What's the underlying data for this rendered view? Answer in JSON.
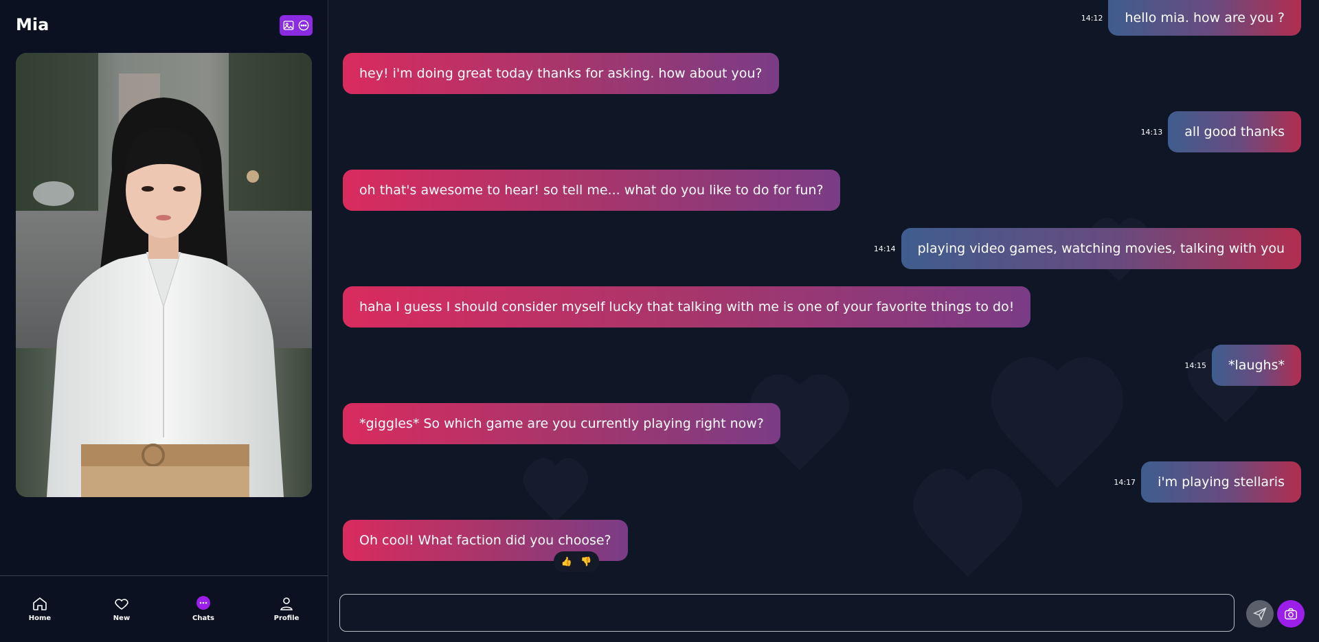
{
  "sidebar": {
    "title": "Mia",
    "action_icons": [
      "image-icon",
      "chat-dots-icon"
    ],
    "portrait": "profile-photo"
  },
  "nav": {
    "items": [
      {
        "label": "Home",
        "icon": "home-icon"
      },
      {
        "label": "New",
        "icon": "heart-icon"
      },
      {
        "label": "Chats",
        "icon": "chat-bubble-icon",
        "active": true
      },
      {
        "label": "Profile",
        "icon": "user-icon"
      }
    ]
  },
  "messages": [
    {
      "from": "me",
      "time": "14:12",
      "text": "hello mia. how are you ?"
    },
    {
      "from": "bot",
      "text": "hey! i'm doing great today thanks for asking. how about you?"
    },
    {
      "from": "me",
      "time": "14:13",
      "text": "all good thanks"
    },
    {
      "from": "bot",
      "text": "oh that's awesome to hear! so tell me... what do you like to do for fun?"
    },
    {
      "from": "me",
      "time": "14:14",
      "text": "playing video games, watching movies, talking with you"
    },
    {
      "from": "bot",
      "text": "haha I guess I should consider myself lucky that talking with me is one of your favorite things to do!"
    },
    {
      "from": "me",
      "time": "14:15",
      "text": "*laughs*"
    },
    {
      "from": "bot",
      "text": "*giggles* So which game are you currently playing right now?"
    },
    {
      "from": "me",
      "time": "14:17",
      "text": "i'm playing stellaris"
    },
    {
      "from": "bot",
      "text": "Oh cool! What faction did you choose?"
    }
  ],
  "reactions": {
    "up": "👍",
    "down": "👎"
  },
  "composer": {
    "value": "",
    "placeholder": ""
  },
  "colors": {
    "accent": "#9b1fe8",
    "sidebar_bg": "#0b1120",
    "chat_bg": "#0f1626"
  }
}
